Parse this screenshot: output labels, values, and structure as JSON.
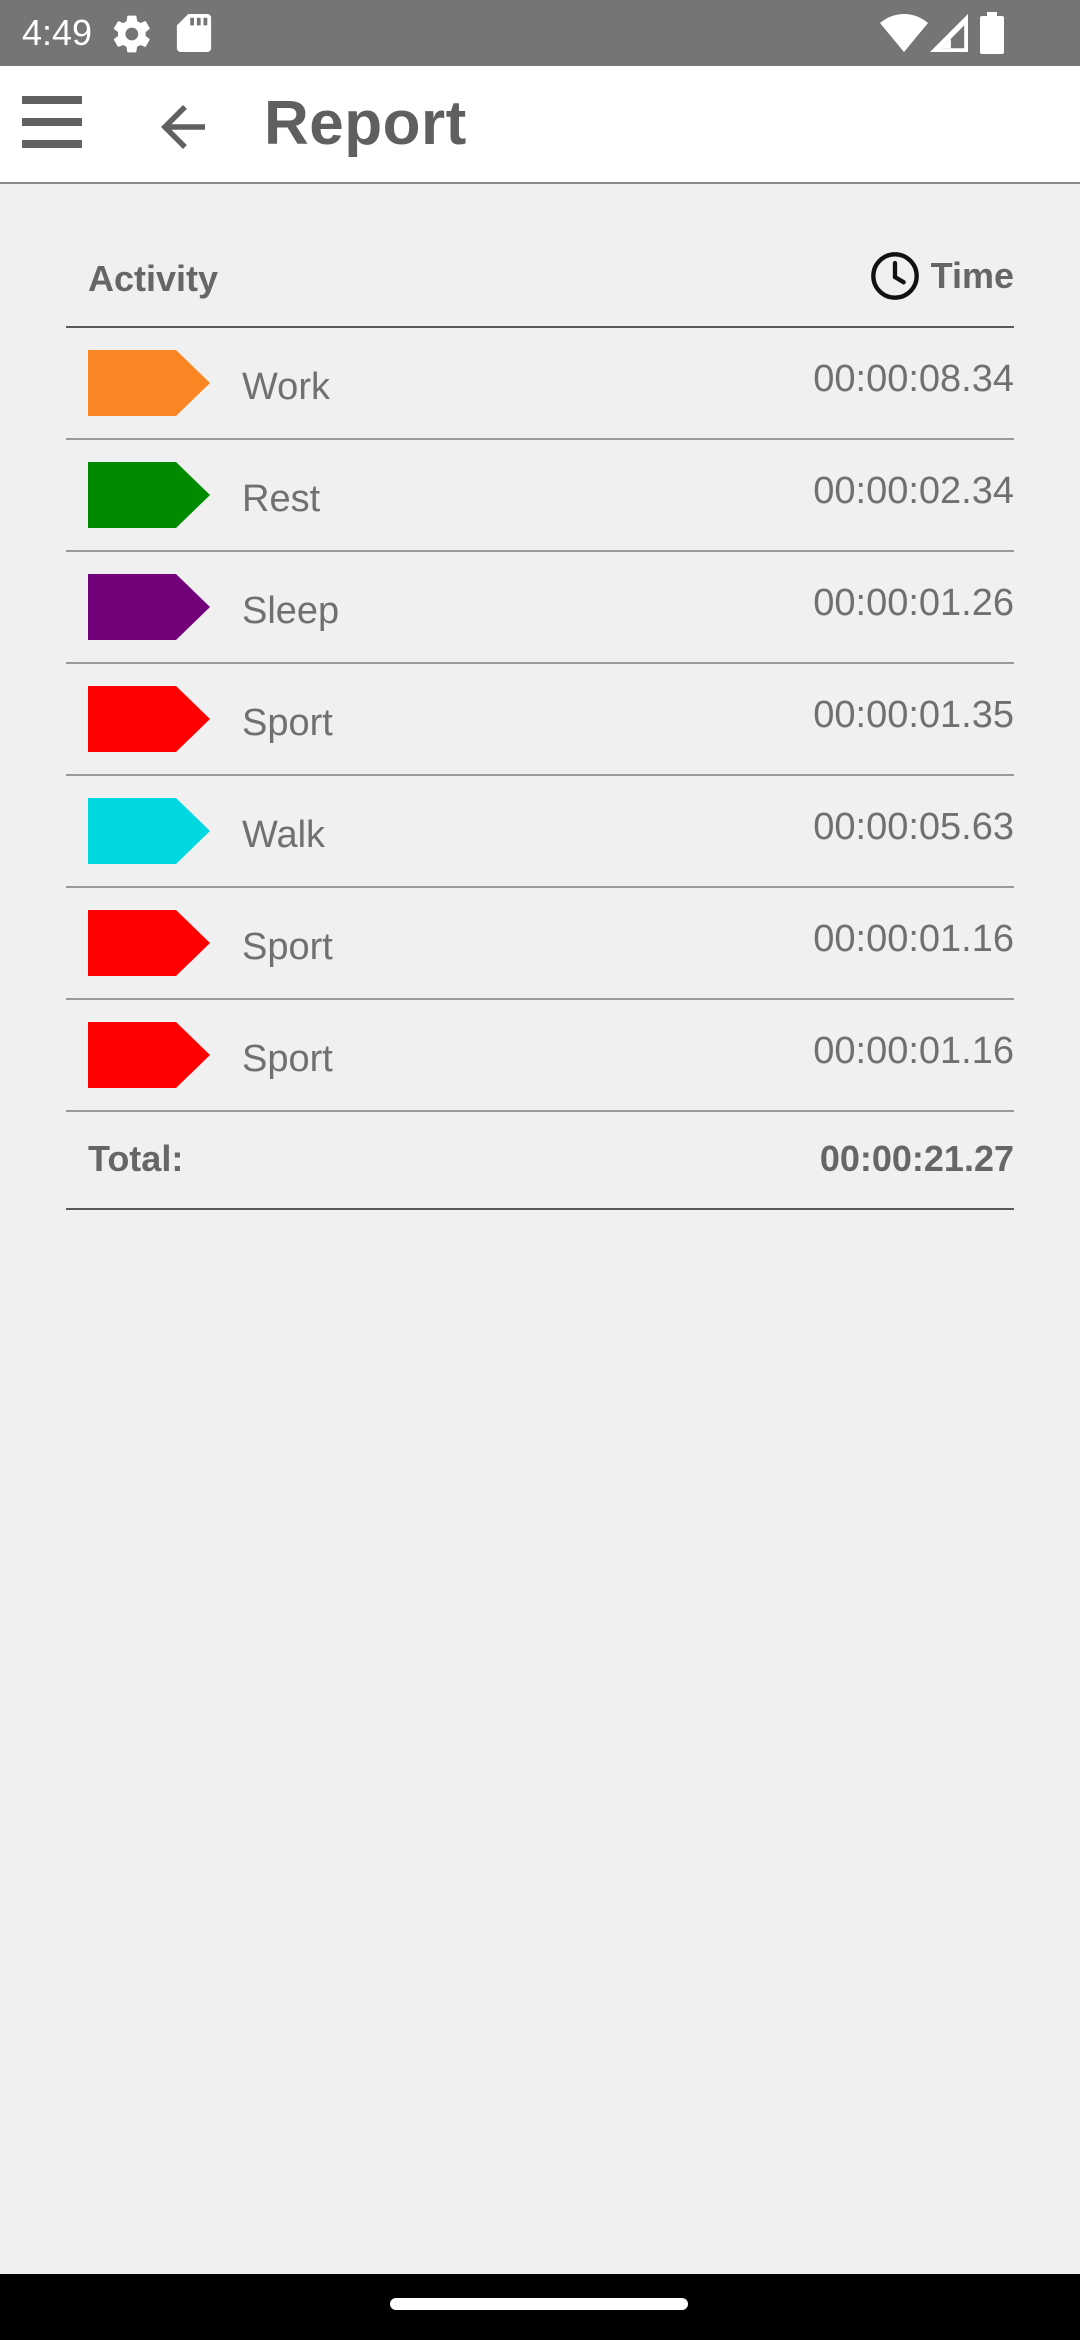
{
  "status_bar": {
    "time": "4:49",
    "icons_left": [
      "settings-icon",
      "sd-card-icon"
    ],
    "icons_right": [
      "wifi-icon",
      "signal-icon",
      "battery-icon"
    ],
    "background": "#757575"
  },
  "app_bar": {
    "title": "Report",
    "menu_icon": "hamburger-menu-icon",
    "back_icon": "arrow-left-icon"
  },
  "table": {
    "header": {
      "activity": "Activity",
      "time": "Time",
      "time_icon": "clock-icon"
    },
    "rows": [
      {
        "name": "Work",
        "time": "00:00:08.34",
        "color": "#fa8623"
      },
      {
        "name": "Rest",
        "time": "00:00:02.34",
        "color": "#008a00"
      },
      {
        "name": "Sleep",
        "time": "00:00:01.26",
        "color": "#710079"
      },
      {
        "name": "Sport",
        "time": "00:00:01.35",
        "color": "#ff0000"
      },
      {
        "name": "Walk",
        "time": "00:00:05.63",
        "color": "#00d8e0"
      },
      {
        "name": "Sport",
        "time": "00:00:01.16",
        "color": "#ff0000"
      },
      {
        "name": "Sport",
        "time": "00:00:01.16",
        "color": "#ff0000"
      }
    ],
    "total": {
      "label": "Total:",
      "value": "00:00:21.27"
    }
  },
  "nav_bar": {
    "home_indicator": "home-indicator"
  }
}
